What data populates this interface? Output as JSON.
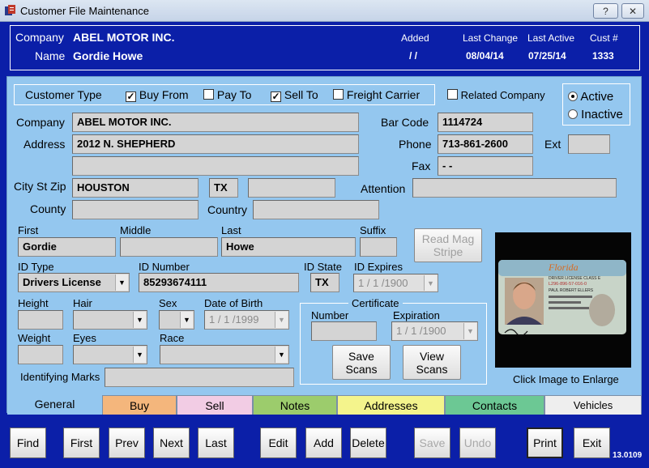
{
  "window": {
    "title": "Customer File Maintenance",
    "help_label": "?"
  },
  "header": {
    "company_label": "Company",
    "company_value": "ABEL MOTOR INC.",
    "name_label": "Name",
    "name_value": "Gordie Howe",
    "added_label": "Added",
    "added_value": "/  /",
    "last_change_label": "Last Change",
    "last_change_value": "08/04/14",
    "last_active_label": "Last Active",
    "last_active_value": "07/25/14",
    "cust_label": "Cust #",
    "cust_value": "1333"
  },
  "customer_type": {
    "label": "Customer Type",
    "options": [
      {
        "label": "Buy From",
        "checked": true
      },
      {
        "label": "Pay To",
        "checked": false
      },
      {
        "label": "Sell To",
        "checked": true
      },
      {
        "label": "Freight Carrier",
        "checked": false
      }
    ],
    "related_company": {
      "label": "Related Company",
      "checked": false
    }
  },
  "status": {
    "active_label": "Active",
    "inactive_label": "Inactive",
    "selected": "Active"
  },
  "address": {
    "company_label": "Company",
    "company_value": "ABEL MOTOR INC.",
    "address_label": "Address",
    "address1": "2012 N. SHEPHERD",
    "address2": "",
    "city_label": "City St Zip",
    "city": "HOUSTON",
    "state": "TX",
    "zip": "",
    "county_label": "County",
    "county": "",
    "country_label": "Country",
    "country": "",
    "barcode_label": "Bar Code",
    "barcode": "1114724",
    "phone_label": "Phone",
    "phone": "713-861-2600",
    "ext_label": "Ext",
    "ext": "",
    "fax_label": "Fax",
    "fax": "-  -",
    "attention_label": "Attention",
    "attention": ""
  },
  "person": {
    "first_label": "First",
    "first": "Gordie",
    "middle_label": "Middle",
    "middle": "",
    "last_label": "Last",
    "last": "Howe",
    "suffix_label": "Suffix",
    "suffix": "",
    "read_mag_label": "Read Mag Stripe",
    "id_type_label": "ID Type",
    "id_type": "Drivers License",
    "id_number_label": "ID Number",
    "id_number": "85293674111",
    "id_state_label": "ID State",
    "id_state": "TX",
    "id_expires_label": "ID Expires",
    "id_expires": "1 / 1 /1900",
    "height_label": "Height",
    "hair_label": "Hair",
    "sex_label": "Sex",
    "dob_label": "Date of Birth",
    "dob": "1 / 1 /1999",
    "weight_label": "Weight",
    "eyes_label": "Eyes",
    "race_label": "Race",
    "marks_label": "Identifying Marks",
    "marks": ""
  },
  "certificate": {
    "title": "Certificate",
    "number_label": "Number",
    "number": "",
    "expiration_label": "Expiration",
    "expiration": "1 / 1 /1900",
    "save_scans_label": "Save Scans",
    "view_scans_label": "View Scans"
  },
  "image": {
    "caption": "Click Image to Enlarge"
  },
  "license": {
    "state": "Florida",
    "subtitle": "DRIVER LICENSE CLASS E",
    "number": "L296-896-57-016-0",
    "name": "PAUL ROBERT ELLERS"
  },
  "tabs": [
    {
      "label": "General",
      "color": "#94c7ef"
    },
    {
      "label": "Buy",
      "color": "#f4b67c"
    },
    {
      "label": "Sell",
      "color": "#f2cce4"
    },
    {
      "label": "Notes",
      "color": "#9ccc6c"
    },
    {
      "label": "Addresses",
      "color": "#f4f48c"
    },
    {
      "label": "Contacts",
      "color": "#6cc894"
    },
    {
      "label": "Vehicles",
      "color": "#eeeeee"
    }
  ],
  "footer": {
    "buttons": [
      "Find",
      "First",
      "Prev",
      "Next",
      "Last",
      "Edit",
      "Add",
      "Delete",
      "Save",
      "Undo",
      "Print",
      "Exit"
    ],
    "version": "13.0109"
  }
}
